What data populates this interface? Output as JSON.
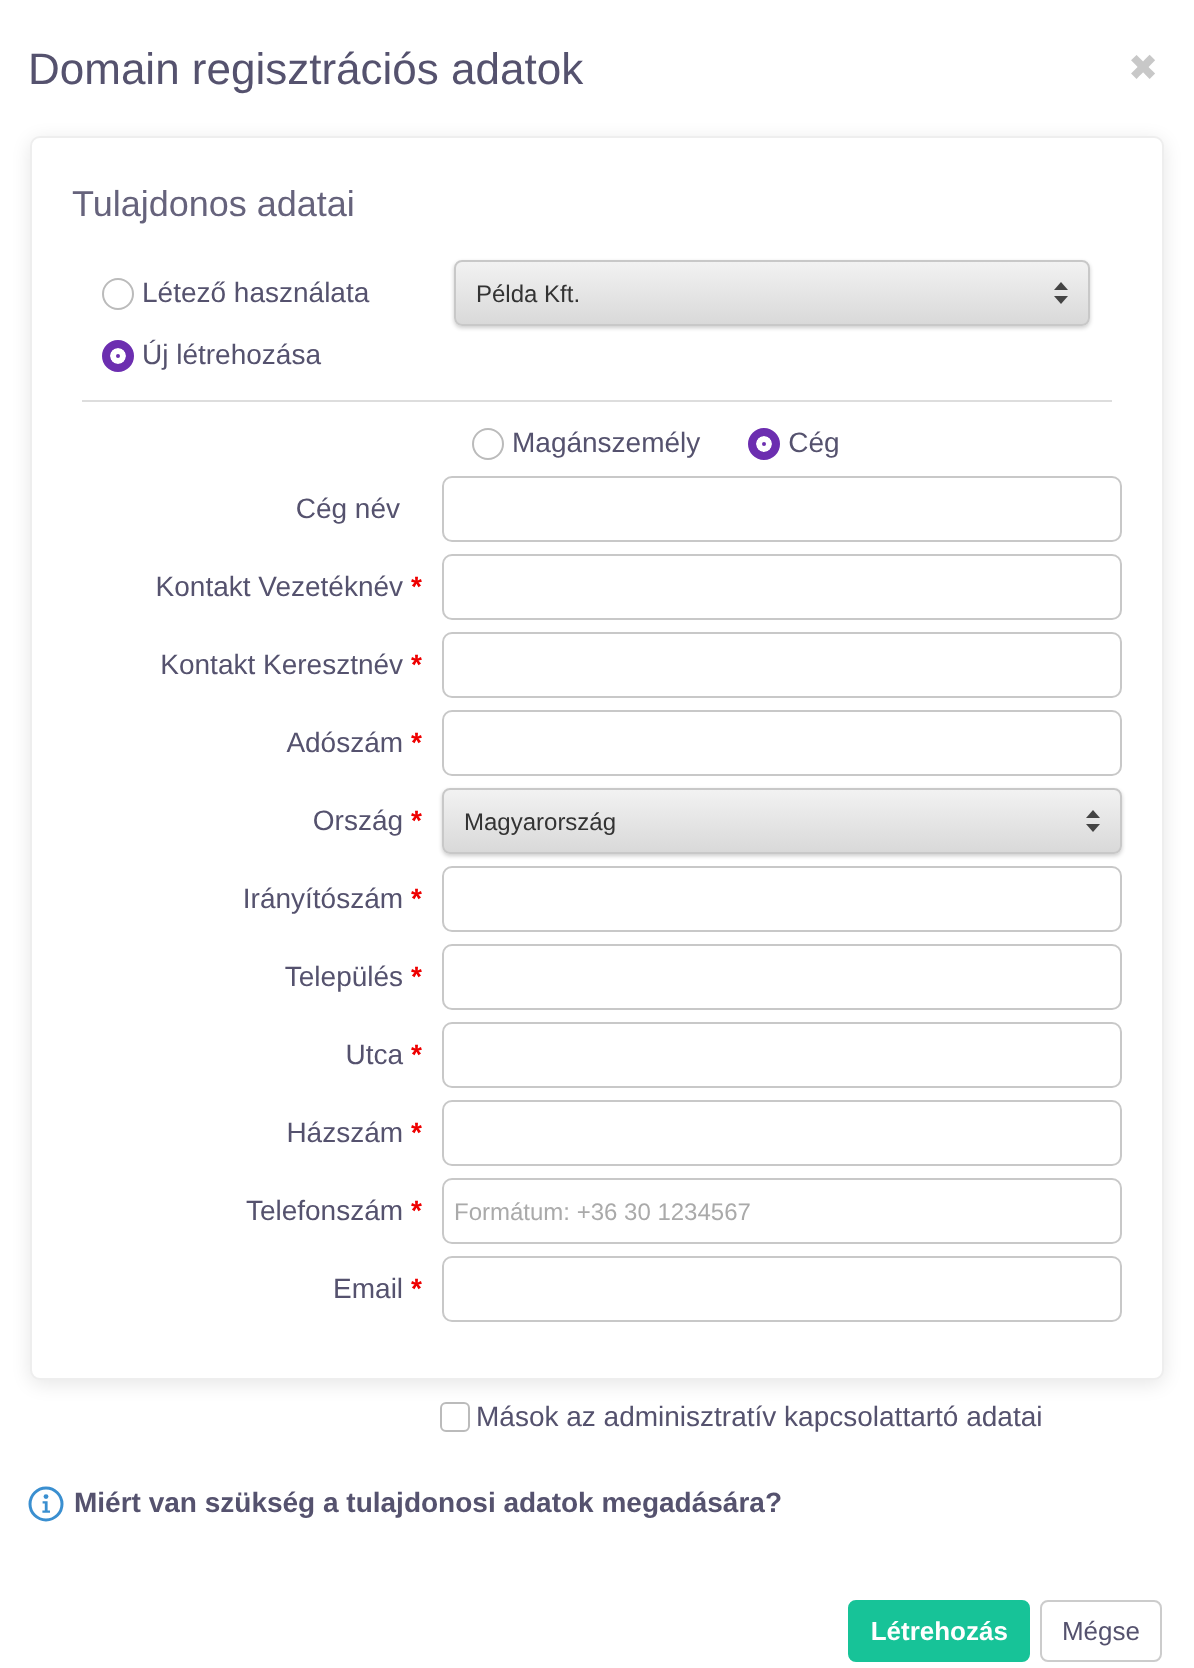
{
  "dialog": {
    "title": "Domain regisztrációs adatok",
    "close": "✖"
  },
  "card": {
    "title": "Tulajdonos adatai",
    "owner_options": [
      {
        "label": "Létező használata",
        "selected": false
      },
      {
        "label": "Új létrehozása",
        "selected": true
      }
    ],
    "existing_select": {
      "value": "Példa Kft."
    },
    "type_options": [
      {
        "label": "Magánszemély",
        "selected": false
      },
      {
        "label": "Cég",
        "selected": true
      }
    ],
    "fields": [
      {
        "label": "Cég név",
        "kind": "text"
      },
      {
        "label": "Kontakt Vezetéknév",
        "required_mark": "*",
        "kind": "text"
      },
      {
        "label": "Kontakt Keresztnév",
        "required_mark": "*",
        "kind": "text"
      },
      {
        "label": "Adószám",
        "required_mark": "*",
        "kind": "text"
      },
      {
        "label": "Ország",
        "required_mark": "*",
        "kind": "select",
        "value": "Magyarország"
      },
      {
        "label": "Irányítószám",
        "required_mark": "*",
        "kind": "text"
      },
      {
        "label": "Település",
        "required_mark": "*",
        "kind": "text"
      },
      {
        "label": "Utca",
        "required_mark": "*",
        "kind": "text"
      },
      {
        "label": "Házszám",
        "required_mark": "*",
        "kind": "text"
      },
      {
        "label": "Telefonszám",
        "required_mark": "*",
        "kind": "text",
        "placeholder": "Formátum: +36 30 1234567"
      },
      {
        "label": "Email",
        "required_mark": "*",
        "kind": "text"
      }
    ]
  },
  "admin_checkbox": {
    "label": "Mások az adminisztratív kapcsolattartó adatai",
    "checked": false
  },
  "info_link": "Miért van szükség a tulajdonosi adatok megadására?",
  "buttons": [
    {
      "label": "Létrehozás",
      "kind": "primary"
    },
    {
      "label": "Mégse",
      "kind": "secondary"
    }
  ]
}
